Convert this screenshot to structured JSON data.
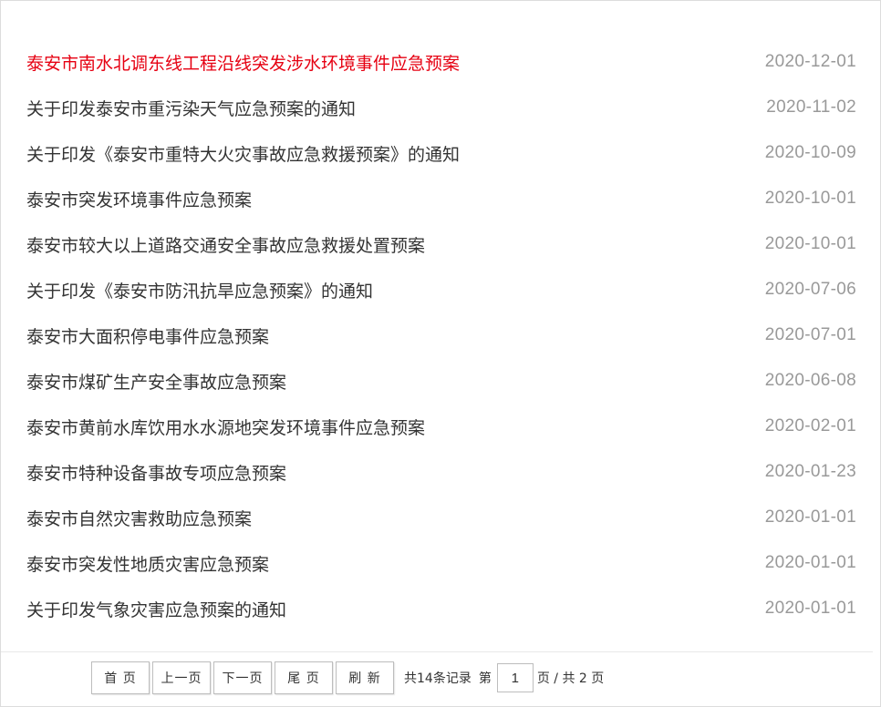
{
  "list": {
    "items": [
      {
        "title": "泰安市南水北调东线工程沿线突发涉水环境事件应急预案",
        "date": "2020-12-01"
      },
      {
        "title": "关于印发泰安市重污染天气应急预案的通知",
        "date": "2020-11-02"
      },
      {
        "title": "关于印发《泰安市重特大火灾事故应急救援预案》的通知",
        "date": "2020-10-09"
      },
      {
        "title": "泰安市突发环境事件应急预案",
        "date": "2020-10-01"
      },
      {
        "title": "泰安市较大以上道路交通安全事故应急救援处置预案",
        "date": "2020-10-01"
      },
      {
        "title": "关于印发《泰安市防汛抗旱应急预案》的通知",
        "date": "2020-07-06"
      },
      {
        "title": "泰安市大面积停电事件应急预案",
        "date": "2020-07-01"
      },
      {
        "title": "泰安市煤矿生产安全事故应急预案",
        "date": "2020-06-08"
      },
      {
        "title": "泰安市黄前水库饮用水水源地突发环境事件应急预案",
        "date": "2020-02-01"
      },
      {
        "title": "泰安市特种设备事故专项应急预案",
        "date": "2020-01-23"
      },
      {
        "title": "泰安市自然灾害救助应急预案",
        "date": "2020-01-01"
      },
      {
        "title": "泰安市突发性地质灾害应急预案",
        "date": "2020-01-01"
      },
      {
        "title": "关于印发气象灾害应急预案的通知",
        "date": "2020-01-01"
      }
    ]
  },
  "pager": {
    "first_label": "首 页",
    "prev_label": "上一页",
    "next_label": "下一页",
    "last_label": "尾 页",
    "refresh_label": "刷 新",
    "total_text": "共14条记录",
    "page_prefix": "第",
    "current_page": "1",
    "page_suffix": "页 / 共 2 页"
  },
  "colors": {
    "active_title": "#e60012",
    "title": "#333333",
    "date": "#999999"
  }
}
